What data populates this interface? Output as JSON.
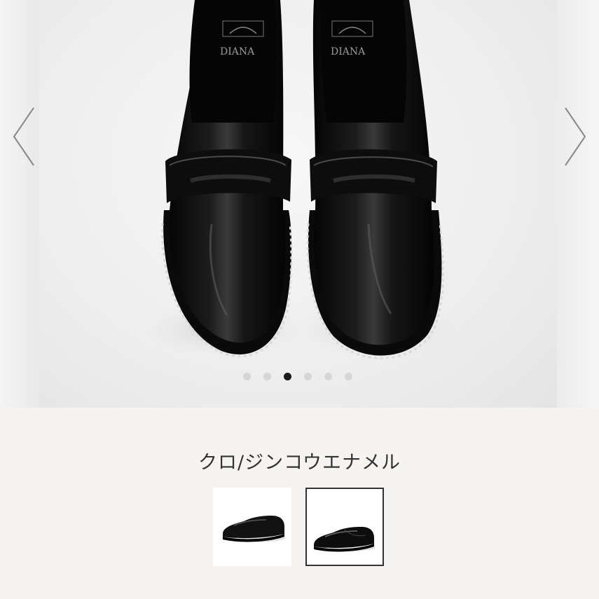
{
  "carousel": {
    "prev_icon": "chevron-left-icon",
    "next_icon": "chevron-right-icon",
    "brand_text": "DIANA",
    "dots": [
      {
        "active": false
      },
      {
        "active": false
      },
      {
        "active": true
      },
      {
        "active": false
      },
      {
        "active": false
      },
      {
        "active": false
      }
    ]
  },
  "product": {
    "color_name": "クロ/ジンコウエナメル",
    "swatches": [
      {
        "id": "swatch-1",
        "selected": false
      },
      {
        "id": "swatch-2",
        "selected": true
      }
    ]
  },
  "colors": {
    "background": "#f5f4f2",
    "shoe": "#0b0b0b",
    "selected_border": "#333333",
    "dot_active": "#1a1a1a",
    "dot_inactive": "#d6d6d6"
  }
}
